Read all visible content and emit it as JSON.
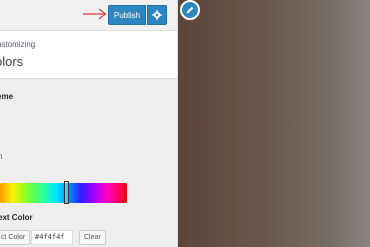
{
  "toolbar": {
    "publish_label": "Publish",
    "settings_icon": "gear-icon",
    "arrow_icon": "arrow-right-icon",
    "accent_color": "#2e86c1",
    "arrow_color": "#e0383e"
  },
  "panel": {
    "subheading": "ustomizing",
    "title": "olors"
  },
  "section": {
    "scheme_label": "eme",
    "n_label": "n",
    "text_color_label": "ext Color"
  },
  "color_picker": {
    "select_label": "ct Color",
    "hex_value": "#4f4f4f",
    "clear_label": "Clear"
  },
  "preview": {
    "edit_icon": "pencil-icon"
  }
}
